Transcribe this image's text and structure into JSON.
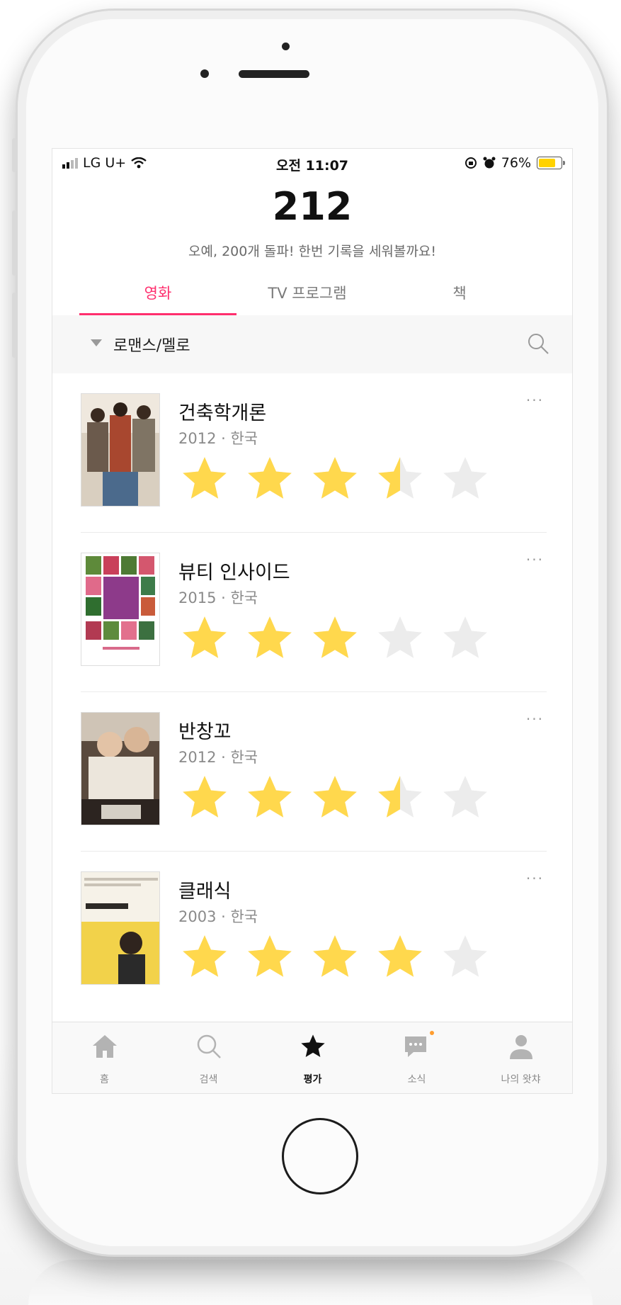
{
  "status_bar": {
    "carrier": "LG U+",
    "time": "오전 11:07",
    "battery_pct": "76%",
    "battery_level": 0.76
  },
  "header": {
    "count": "212",
    "subtitle": "오예, 200개 돌파! 한번 기록을 세워볼까요!"
  },
  "tabs": [
    {
      "label": "영화",
      "active": true
    },
    {
      "label": "TV 프로그램",
      "active": false
    },
    {
      "label": "책",
      "active": false
    }
  ],
  "filter": {
    "genre": "로맨스/멜로"
  },
  "movies": [
    {
      "title": "건축학개론",
      "meta": "2012 · 한국",
      "rating": 3.5
    },
    {
      "title": "뷰티 인사이드",
      "meta": "2015 · 한국",
      "rating": 3
    },
    {
      "title": "반창꼬",
      "meta": "2012 · 한국",
      "rating": 3.5
    },
    {
      "title": "클래식",
      "meta": "2003 · 한국",
      "rating": 4
    }
  ],
  "more_label": "···",
  "bottom_nav": [
    {
      "label": "홈",
      "icon": "home-icon",
      "active": false
    },
    {
      "label": "검색",
      "icon": "search-icon",
      "active": false
    },
    {
      "label": "평가",
      "icon": "star-icon",
      "active": true
    },
    {
      "label": "소식",
      "icon": "chat-bubble-icon",
      "active": false
    },
    {
      "label": "나의 왓챠",
      "icon": "person-icon",
      "active": false
    }
  ],
  "colors": {
    "accent": "#ff2f6e",
    "star_filled": "#ffd84d",
    "star_empty": "#ececec"
  }
}
